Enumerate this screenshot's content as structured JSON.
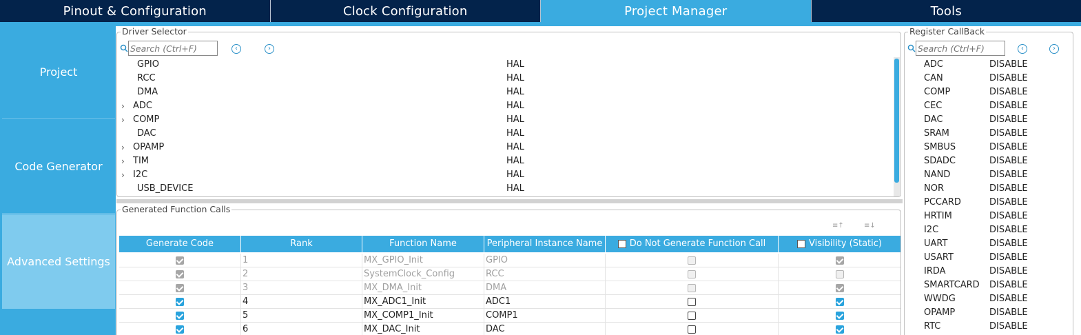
{
  "tabs": [
    {
      "label": "Pinout & Configuration",
      "active": false
    },
    {
      "label": "Clock Configuration",
      "active": false
    },
    {
      "label": "Project Manager",
      "active": true
    },
    {
      "label": "Tools",
      "active": false
    }
  ],
  "sidebar": {
    "items": [
      {
        "label": "Project",
        "selected": false
      },
      {
        "label": "Code Generator",
        "selected": false
      },
      {
        "label": "Advanced Settings",
        "selected": true
      }
    ]
  },
  "driver_selector": {
    "title": "Driver Selector",
    "search_placeholder": "Search (Ctrl+F)",
    "prev_icon": "circle-left-arrow-icon",
    "next_icon": "circle-right-arrow-icon",
    "rows": [
      {
        "name": "GPIO",
        "value": "HAL",
        "expandable": false
      },
      {
        "name": "RCC",
        "value": "HAL",
        "expandable": false
      },
      {
        "name": "DMA",
        "value": "HAL",
        "expandable": false
      },
      {
        "name": "ADC",
        "value": "HAL",
        "expandable": true
      },
      {
        "name": "COMP",
        "value": "HAL",
        "expandable": true
      },
      {
        "name": "DAC",
        "value": "HAL",
        "expandable": false
      },
      {
        "name": "OPAMP",
        "value": "HAL",
        "expandable": true
      },
      {
        "name": "TIM",
        "value": "HAL",
        "expandable": true
      },
      {
        "name": "I2C",
        "value": "HAL",
        "expandable": true
      },
      {
        "name": "USB_DEVICE",
        "value": "HAL",
        "expandable": false
      }
    ]
  },
  "generated_calls": {
    "title": "Generated Function Calls",
    "columns": {
      "generate_code": "Generate Code",
      "rank": "Rank",
      "function_name": "Function Name",
      "peripheral": "Peripheral Instance Name",
      "do_not_generate": "Do Not Generate Function Call",
      "visibility": "Visibility (Static)"
    },
    "rows": [
      {
        "generate": true,
        "rank": "1",
        "function": "MX_GPIO_Init",
        "peripheral": "GPIO",
        "do_not_generate": false,
        "visibility": true,
        "disabled": true
      },
      {
        "generate": true,
        "rank": "2",
        "function": "SystemClock_Config",
        "peripheral": "RCC",
        "do_not_generate": false,
        "visibility": false,
        "disabled": true
      },
      {
        "generate": true,
        "rank": "3",
        "function": "MX_DMA_Init",
        "peripheral": "DMA",
        "do_not_generate": false,
        "visibility": true,
        "disabled": true
      },
      {
        "generate": true,
        "rank": "4",
        "function": "MX_ADC1_Init",
        "peripheral": "ADC1",
        "do_not_generate": false,
        "visibility": true,
        "disabled": false
      },
      {
        "generate": true,
        "rank": "5",
        "function": "MX_COMP1_Init",
        "peripheral": "COMP1",
        "do_not_generate": false,
        "visibility": true,
        "disabled": false
      },
      {
        "generate": true,
        "rank": "6",
        "function": "MX_DAC_Init",
        "peripheral": "DAC",
        "do_not_generate": false,
        "visibility": true,
        "disabled": false
      }
    ]
  },
  "register_callback": {
    "title": "Register CallBack",
    "search_placeholder": "Search (Ctrl+F)",
    "rows": [
      {
        "name": "ADC",
        "value": "DISABLE"
      },
      {
        "name": "CAN",
        "value": "DISABLE"
      },
      {
        "name": "COMP",
        "value": "DISABLE"
      },
      {
        "name": "CEC",
        "value": "DISABLE"
      },
      {
        "name": "DAC",
        "value": "DISABLE"
      },
      {
        "name": "SRAM",
        "value": "DISABLE"
      },
      {
        "name": "SMBUS",
        "value": "DISABLE"
      },
      {
        "name": "SDADC",
        "value": "DISABLE"
      },
      {
        "name": "NAND",
        "value": "DISABLE"
      },
      {
        "name": "NOR",
        "value": "DISABLE"
      },
      {
        "name": "PCCARD",
        "value": "DISABLE"
      },
      {
        "name": "HRTIM",
        "value": "DISABLE"
      },
      {
        "name": "I2C",
        "value": "DISABLE"
      },
      {
        "name": "UART",
        "value": "DISABLE"
      },
      {
        "name": "USART",
        "value": "DISABLE"
      },
      {
        "name": "IRDA",
        "value": "DISABLE"
      },
      {
        "name": "SMARTCARD",
        "value": "DISABLE"
      },
      {
        "name": "WWDG",
        "value": "DISABLE"
      },
      {
        "name": "OPAMP",
        "value": "DISABLE"
      },
      {
        "name": "RTC",
        "value": "DISABLE"
      }
    ]
  },
  "colors": {
    "navy": "#03234b",
    "accent": "#3aabe0",
    "sidebar_selected": "#7fcbee"
  }
}
